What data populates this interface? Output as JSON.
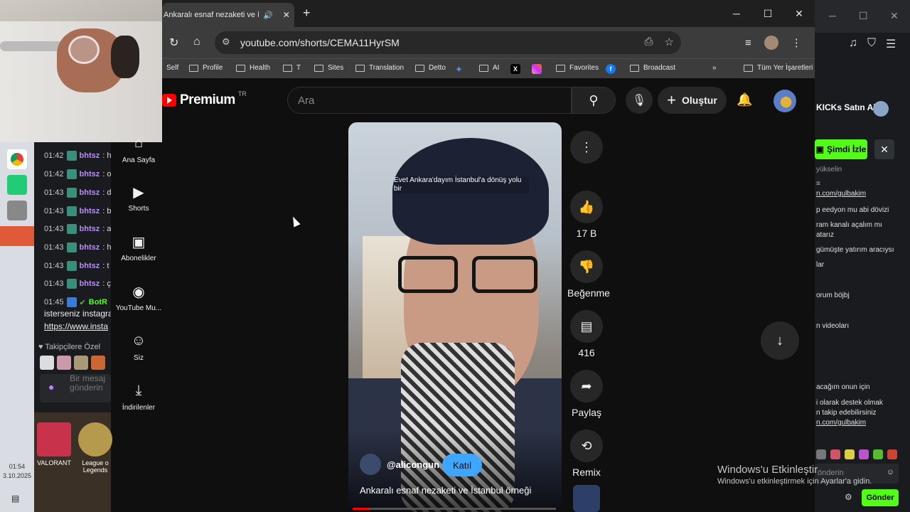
{
  "browser": {
    "tab_title": "Ankaralı esnaf nezaketi ve İstanbul ö...",
    "url": "youtube.com/shorts/CEMA11HyrSM",
    "bookmarks": [
      "Self",
      "Profile",
      "Health",
      "T",
      "Sites",
      "Translation",
      "Detto",
      "AI",
      "Favorites",
      "Broadcast"
    ],
    "all_bookmarks": "Tüm Yer İşaretleri"
  },
  "youtube": {
    "logo_text": "Premium",
    "region": "TR",
    "search_placeholder": "Ara",
    "create_label": "Oluştur",
    "guide": [
      "Ana Sayfa",
      "Shorts",
      "Abonelikler",
      "YouTube Mu...",
      "Siz",
      "İndirilenler"
    ],
    "short": {
      "caption": "Evet Ankara'dayım İstanbul'a dönüş yolu bir",
      "channel": "@alicongun",
      "join_label": "Katıl",
      "title": "Ankaralı esnaf nezaketi ve İstanbul örneği",
      "progress": 0.08
    },
    "actions": {
      "likes": "17 B",
      "dislike_label": "Beğenme",
      "comments": "416",
      "share_label": "Paylaş",
      "remix_label": "Remix"
    }
  },
  "left_chat": {
    "rows": [
      {
        "time": "01:42",
        "user": "bhtsz",
        "msg": ": h"
      },
      {
        "time": "01:42",
        "user": "bhtsz",
        "msg": ": o"
      },
      {
        "time": "01:43",
        "user": "bhtsz",
        "msg": ": d"
      },
      {
        "time": "01:43",
        "user": "bhtsz",
        "msg": ": b"
      },
      {
        "time": "01:43",
        "user": "bhtsz",
        "msg": ": a"
      },
      {
        "time": "01:43",
        "user": "bhtsz",
        "msg": ": h"
      },
      {
        "time": "01:43",
        "user": "bhtsz",
        "msg": ": t"
      },
      {
        "time": "01:43",
        "user": "bhtsz",
        "msg": ": ç"
      }
    ],
    "bot_time": "01:45",
    "bot_user": "BotR",
    "bot_line1": "isterseniz instagra",
    "bot_link": "https://www.insta",
    "followers_label": "Takipçilere Özel",
    "input_placeholder": "Bir mesaj gönderin",
    "desktop_icons": [
      "VALORANT",
      "League o Legends"
    ],
    "clock_time": "01:54",
    "clock_date": "3.10.2025"
  },
  "right_chat": {
    "buy_label": "KICKs Satın Al",
    "watch_label": "Şimdi İzle",
    "fragments": [
      "yükselin",
      "n.com/gulbakim",
      "p eedyon mu abi dövizi",
      "ram kanalı açalım mı",
      "atarız",
      "gümüşte yatırım aracıysı",
      "lar",
      "orum böjbj",
      "n videoları",
      "acağım onun için",
      "i olarak destek olmak",
      "n takip edebilirsiniz",
      "n.com/gulbakim"
    ],
    "input_placeholder": "önderin",
    "send_label": "Gönder"
  },
  "windows": {
    "activate_title": "Windows'u Etkinleştir",
    "activate_sub": "Windows'u etkinleştirmek için Ayarlar'a gidin."
  }
}
